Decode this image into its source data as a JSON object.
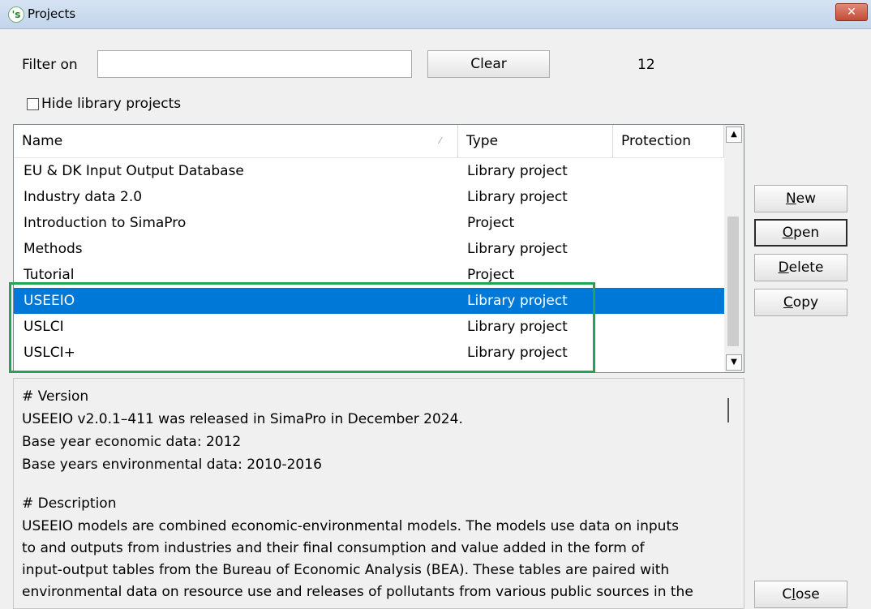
{
  "window": {
    "title": "Projects",
    "app_icon_glyph": "'s",
    "close_glyph": "✕"
  },
  "filter": {
    "label": "Filter on",
    "value": "",
    "clear_label": "Clear",
    "count": "12"
  },
  "hide_library": {
    "label": "Hide library projects",
    "checked": false
  },
  "table": {
    "columns": [
      "Name",
      "Type",
      "Protection"
    ],
    "rows": [
      {
        "name": "EU & DK Input Output Database",
        "type": "Library project",
        "protection": ""
      },
      {
        "name": "Industry data 2.0",
        "type": "Library project",
        "protection": ""
      },
      {
        "name": "Introduction to SimaPro",
        "type": "Project",
        "protection": ""
      },
      {
        "name": "Methods",
        "type": "Library project",
        "protection": ""
      },
      {
        "name": "Tutorial",
        "type": "Project",
        "protection": ""
      },
      {
        "name": "USEEIO",
        "type": "Library project",
        "protection": "",
        "selected": true
      },
      {
        "name": "USLCI",
        "type": "Library project",
        "protection": ""
      },
      {
        "name": "USLCI+",
        "type": "Library project",
        "protection": ""
      }
    ]
  },
  "buttons": {
    "new": {
      "pre": "",
      "key": "N",
      "post": "ew"
    },
    "open": {
      "pre": "",
      "key": "O",
      "post": "pen"
    },
    "delete": {
      "pre": "",
      "key": "D",
      "post": "elete"
    },
    "copy": {
      "pre": "",
      "key": "C",
      "post": "opy"
    },
    "close": {
      "pre": "C",
      "key": "l",
      "post": "ose"
    }
  },
  "description": {
    "lines": [
      "# Version",
      "USEEIO v2.0.1–411 was released in SimaPro in December 2024.",
      "Base year economic data: 2012",
      "Base years environmental data: 2010-2016",
      "",
      "# Description",
      "USEEIO models are combined economic-environmental models. The models use data on inputs",
      "to and outputs from industries and their final consumption and value added in the form of",
      "input-output tables from the Bureau of Economic Analysis (BEA). These tables are paired with",
      "environmental data on resource use and releases of pollutants from various public sources in the"
    ]
  },
  "colors": {
    "selection": "#0078d7",
    "highlight_box": "#23a455"
  }
}
